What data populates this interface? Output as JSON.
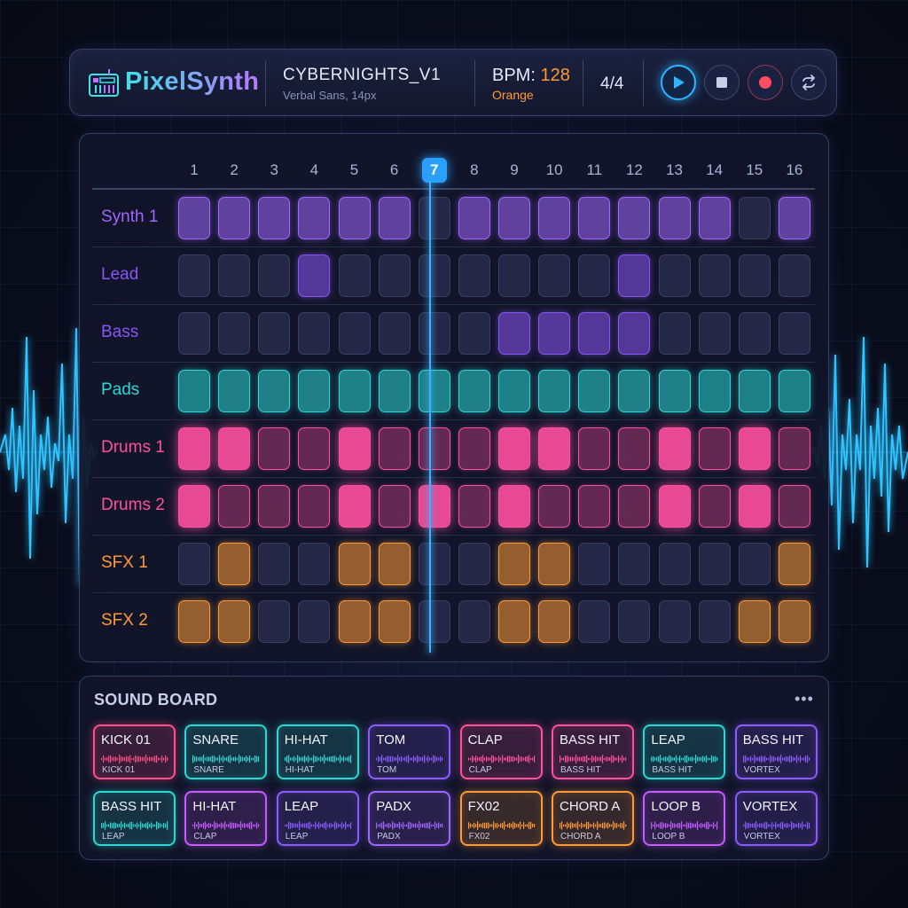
{
  "app": {
    "name": "PixelSynth"
  },
  "project": {
    "name": "CYBERNIGHTS_V1",
    "font_note": "Verbal Sans, 14px"
  },
  "tempo": {
    "bpm_label": "BPM:",
    "bpm_value": "128",
    "color_label": "Orange",
    "time_signature": "4/4"
  },
  "transport": {
    "buttons": [
      {
        "name": "play",
        "icon": "play-icon"
      },
      {
        "name": "stop",
        "icon": "stop-icon"
      },
      {
        "name": "record",
        "icon": "record-icon"
      },
      {
        "name": "loop",
        "icon": "loop-icon"
      }
    ]
  },
  "sequencer": {
    "steps": [
      "1",
      "2",
      "3",
      "4",
      "5",
      "6",
      "7",
      "8",
      "9",
      "10",
      "11",
      "12",
      "13",
      "14",
      "15",
      "16"
    ],
    "current_step": 7,
    "tracks": [
      {
        "name": "Synth 1",
        "color": "#a066ff",
        "pattern": [
          1,
          1,
          1,
          1,
          1,
          1,
          0,
          1,
          1,
          1,
          1,
          1,
          1,
          1,
          0,
          1
        ]
      },
      {
        "name": "Lead",
        "color": "#8a55f5",
        "pattern": [
          0,
          0,
          0,
          1,
          0,
          0,
          0,
          0,
          0,
          0,
          0,
          1,
          0,
          0,
          0,
          0
        ]
      },
      {
        "name": "Bass",
        "color": "#8a55f5",
        "pattern": [
          0,
          0,
          0,
          0,
          0,
          0,
          0,
          0,
          1,
          1,
          1,
          1,
          0,
          0,
          0,
          0
        ]
      },
      {
        "name": "Pads",
        "color": "#2ad9d5",
        "pattern": [
          1,
          1,
          1,
          1,
          1,
          1,
          1,
          1,
          1,
          1,
          1,
          1,
          1,
          1,
          1,
          1
        ]
      },
      {
        "name": "Drums 1",
        "color": "#ff4f9d",
        "pattern": [
          2,
          2,
          1,
          1,
          2,
          1,
          1,
          1,
          2,
          2,
          1,
          1,
          2,
          1,
          2,
          1
        ]
      },
      {
        "name": "Drums 2",
        "color": "#ff4f9d",
        "pattern": [
          2,
          1,
          1,
          1,
          2,
          1,
          2,
          1,
          2,
          1,
          1,
          1,
          2,
          1,
          2,
          1
        ]
      },
      {
        "name": "SFX 1",
        "color": "#ff9a36",
        "pattern": [
          0,
          1,
          0,
          0,
          1,
          1,
          0,
          0,
          1,
          1,
          0,
          0,
          0,
          0,
          0,
          1
        ]
      },
      {
        "name": "SFX 2",
        "color": "#ff9a36",
        "pattern": [
          1,
          1,
          0,
          0,
          1,
          1,
          0,
          0,
          1,
          1,
          0,
          0,
          0,
          0,
          1,
          1
        ]
      }
    ]
  },
  "sound_board": {
    "title": "SOUND BOARD",
    "more_label": "•••",
    "pads": [
      {
        "title": "KICK 01",
        "sub": "KICK 01",
        "color": "#ff4f8b"
      },
      {
        "title": "SNARE",
        "sub": "SNARE",
        "color": "#2ad9d5"
      },
      {
        "title": "HI-HAT",
        "sub": "HI-HAT",
        "color": "#2ad9d5"
      },
      {
        "title": "TOM",
        "sub": "TOM",
        "color": "#8a5cff"
      },
      {
        "title": "CLAP",
        "sub": "CLAP",
        "color": "#ff4f9d"
      },
      {
        "title": "BASS HIT",
        "sub": "BASS HIT",
        "color": "#ff4f9d"
      },
      {
        "title": "LEAP",
        "sub": "BASS HIT",
        "color": "#2ad9d5"
      },
      {
        "title": "BASS HIT",
        "sub": "VORTEX",
        "color": "#8a5cff"
      },
      {
        "title": "BASS HIT",
        "sub": "LEAP",
        "color": "#2ad9d5"
      },
      {
        "title": "HI-HAT",
        "sub": "CLAP",
        "color": "#c45cff"
      },
      {
        "title": "LEAP",
        "sub": "LEAP",
        "color": "#8a5cff"
      },
      {
        "title": "PADX",
        "sub": "PADX",
        "color": "#a066ff"
      },
      {
        "title": "FX02",
        "sub": "FX02",
        "color": "#ff9a36"
      },
      {
        "title": "CHORD A",
        "sub": "CHORD A",
        "color": "#ff9a36"
      },
      {
        "title": "LOOP B",
        "sub": "LOOP B",
        "color": "#c45cff"
      },
      {
        "title": "VORTEX",
        "sub": "VORTEX",
        "color": "#8a5cff"
      }
    ]
  }
}
